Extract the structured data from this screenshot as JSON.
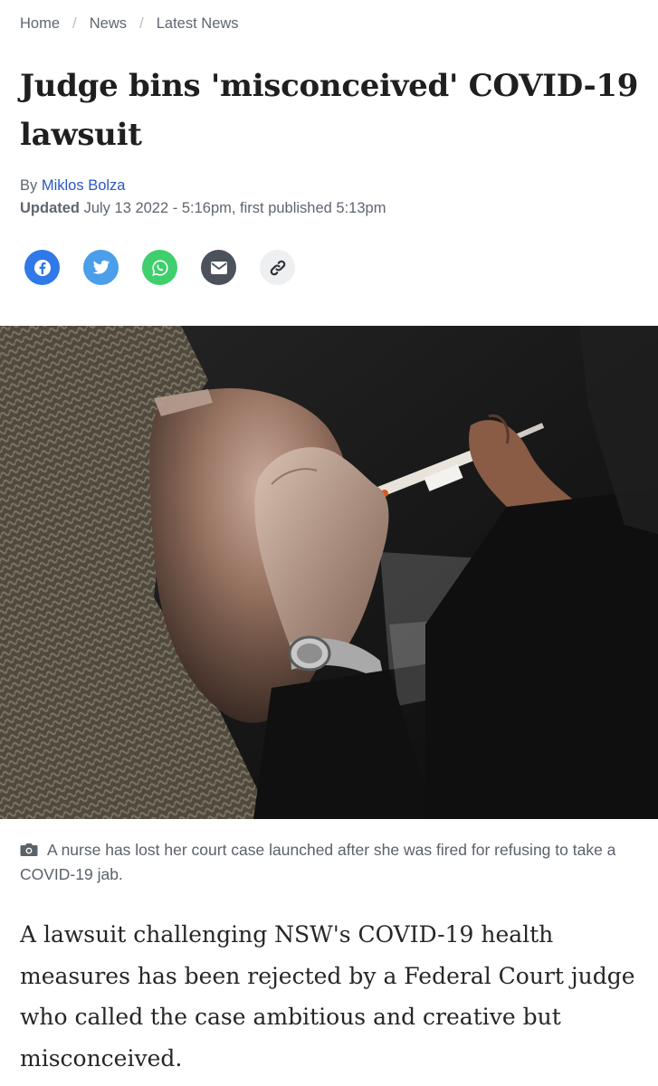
{
  "breadcrumb": {
    "items": [
      "Home",
      "News",
      "Latest News"
    ],
    "separator": "/"
  },
  "article": {
    "headline": "Judge bins 'misconceived' COVID-19 lawsuit",
    "byline_prefix": "By",
    "author": "Miklos Bolza",
    "updated_label": "Updated",
    "updated_text": "July 13 2022 - 5:16pm, first published 5:13pm",
    "image_caption": "A nurse has lost her court case launched after she was fired for refusing to take a COVID-19 jab.",
    "lead_paragraph": "A lawsuit challenging NSW's COVID-19 health measures has been rejected by a Federal Court judge who called the case ambitious and creative but misconceived."
  },
  "share_buttons": [
    {
      "name": "facebook",
      "icon": "facebook-icon",
      "color": "#2f79e8"
    },
    {
      "name": "twitter",
      "icon": "twitter-icon",
      "color": "#4a9eea"
    },
    {
      "name": "whatsapp",
      "icon": "whatsapp-icon",
      "color": "#3fcf6c"
    },
    {
      "name": "email",
      "icon": "envelope-icon",
      "color": "#4b525b"
    },
    {
      "name": "copy-link",
      "icon": "link-icon",
      "color": "#eeeff1"
    }
  ],
  "colors": {
    "link": "#2a56c6",
    "meta_text": "#5f6670",
    "headline": "#1f1f1f"
  }
}
